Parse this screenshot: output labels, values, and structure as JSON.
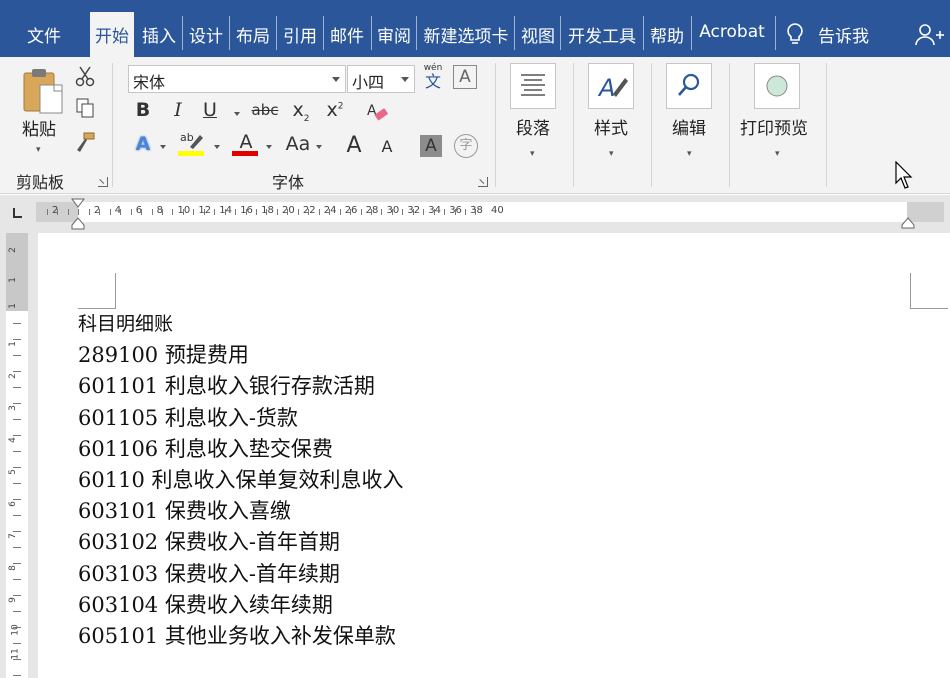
{
  "tabs": [
    {
      "label": "文件",
      "active": false
    },
    {
      "label": "开始",
      "active": true
    },
    {
      "label": "插入",
      "active": false
    },
    {
      "label": "设计",
      "active": false
    },
    {
      "label": "布局",
      "active": false
    },
    {
      "label": "引用",
      "active": false
    },
    {
      "label": "邮件",
      "active": false
    },
    {
      "label": "审阅",
      "active": false
    },
    {
      "label": "新建选项卡",
      "active": false
    },
    {
      "label": "视图",
      "active": false
    },
    {
      "label": "开发工具",
      "active": false
    },
    {
      "label": "帮助",
      "active": false
    },
    {
      "label": "Acrobat",
      "active": false
    }
  ],
  "tell_me": "告诉我",
  "colors": {
    "ribbon_blue": "#2b579a",
    "highlight_yellow": "#ffff00",
    "font_red": "#e00000"
  },
  "clipboard": {
    "paste_label": "粘贴",
    "group_label": "剪贴板"
  },
  "font": {
    "name": "宋体",
    "size": "小四",
    "group_label": "字体",
    "phonetic_top": "wén",
    "phonetic_bottom": "文",
    "border_char": "A",
    "bold": "B",
    "italic": "I",
    "underline": "U",
    "strike": "abc",
    "subscript": "x",
    "sub_mark": "2",
    "superscript": "x",
    "super_mark": "2",
    "highlight_mark": "ab",
    "color_letter": "A",
    "case": "Aa",
    "grow": "A",
    "shrink": "A",
    "shade": "A",
    "enclose": "字"
  },
  "paragraph": {
    "label": "段落"
  },
  "styles": {
    "label": "样式"
  },
  "editing": {
    "label": "编辑"
  },
  "print_preview": {
    "label": "打印预览"
  },
  "ruler_numbers": [
    "2",
    "2",
    "4",
    "6",
    "8",
    "10",
    "12",
    "14",
    "16",
    "18",
    "20",
    "22",
    "24",
    "26",
    "28",
    "30",
    "32",
    "34",
    "36",
    "38",
    "40"
  ],
  "vruler_numbers": [
    "2",
    "1",
    "1",
    "1",
    "2",
    "3",
    "4",
    "5",
    "6",
    "7",
    "8",
    "9",
    "10",
    "11"
  ],
  "document_lines": [
    "科目明细账",
    "289100 预提费用",
    "601101 利息收入银行存款活期",
    "601105 利息收入-货款",
    "601106 利息收入垫交保费",
    "60110 利息收入保单复效利息收入",
    "603101 保费收入喜缴",
    "603102 保费收入-首年首期",
    "603103 保费收入-首年续期",
    "603104 保费收入续年续期",
    "605101 其他业务收入补发保单款"
  ]
}
